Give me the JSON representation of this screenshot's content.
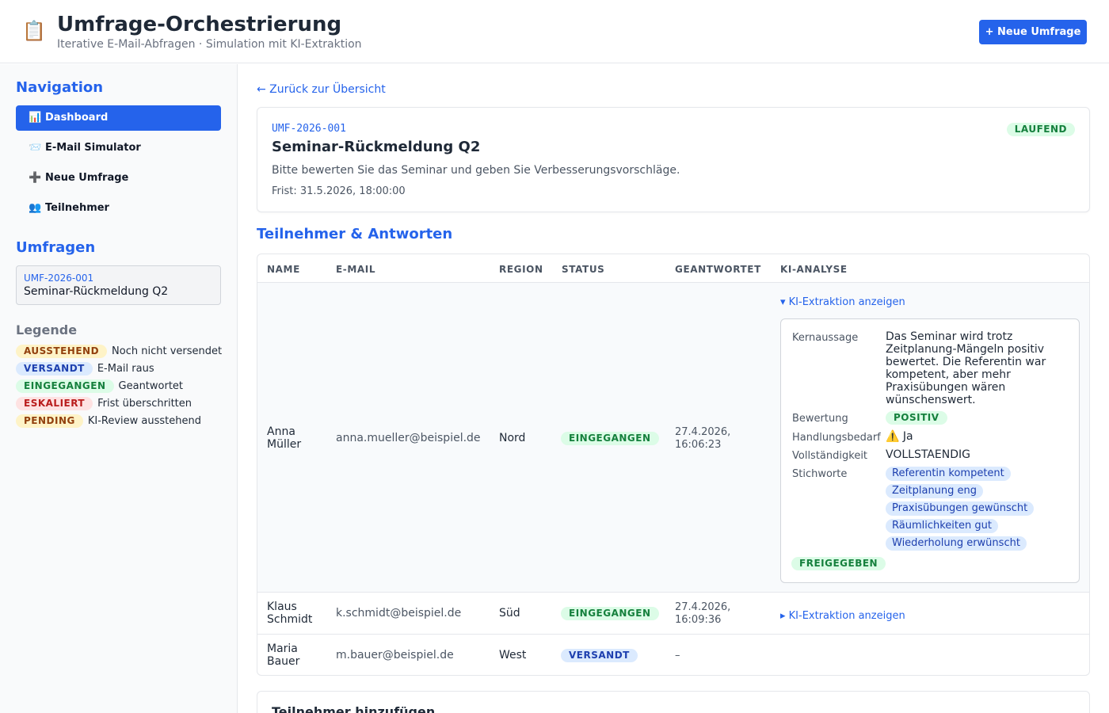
{
  "header": {
    "icon": "clipboard-icon",
    "title": "Umfrage-Orchestrierung",
    "subtitle": "Iterative E-Mail-Abfragen · Simulation mit KI-Extraktion",
    "new_survey_button": "+ Neue Umfrage"
  },
  "sidebar": {
    "nav_title": "Navigation",
    "nav_items": [
      {
        "icon": "📊",
        "label": "Dashboard",
        "active": true
      },
      {
        "icon": "📨",
        "label": "E-Mail Simulator",
        "active": false
      },
      {
        "icon": "➕",
        "label": "Neue Umfrage",
        "active": false
      },
      {
        "icon": "👥",
        "label": "Teilnehmer",
        "active": false
      }
    ],
    "surveys_title": "Umfragen",
    "surveys": [
      {
        "id": "UMF-2026-001",
        "title": "Seminar-Rückmeldung Q2"
      }
    ],
    "legend_title": "Legende",
    "legend": [
      {
        "badge": "AUSSTEHEND",
        "text": "Noch nicht versendet",
        "color": "#fef3c7"
      },
      {
        "badge": "VERSANDT",
        "text": "E-Mail raus",
        "color": "#dbeafe"
      },
      {
        "badge": "EINGEGANGEN",
        "text": "Geantwortet",
        "color": "#dcfce7"
      },
      {
        "badge": "ESKALIERT",
        "text": "Frist überschritten",
        "color": "#fee2e2"
      },
      {
        "badge": "PENDING",
        "text": "KI-Review ausstehend",
        "color": "#fef3c7"
      }
    ]
  },
  "main": {
    "back_link": "← Zurück zur Übersicht",
    "survey": {
      "id": "UMF-2026-001",
      "status": "LAUFEND",
      "title": "Seminar-Rückmeldung Q2",
      "description": "Bitte bewerten Sie das Seminar und geben Sie Verbesserungsvorschläge.",
      "deadline": "Frist: 31.5.2026, 18:00:00"
    },
    "participants_title": "Teilnehmer & Antworten",
    "table": {
      "headers": [
        "NAME",
        "E-MAIL",
        "REGION",
        "STATUS",
        "GEANTWORTET",
        "KI-ANALYSE"
      ],
      "rows": [
        {
          "name_line1": "Anna",
          "name_line2": "Müller",
          "email": "anna.mueller@beispiel.de",
          "region": "Nord",
          "status": "EINGEGANGEN",
          "answered_line1": "27.4.2026,",
          "answered_line2": "16:06:23",
          "ai_toggle": "▾ KI-Extraktion anzeigen",
          "ai": {
            "summary_label": "Kernaussage",
            "summary_lines": [
              "Das Seminar wird trotz",
              "Zeitplanung-Mängeln positiv",
              "bewertet. Die Referentin war",
              "kompetent, aber mehr",
              "Praxisübungen wären",
              "wünschenswert."
            ],
            "rating_label": "Bewertung",
            "rating": "POSITIV",
            "action_label": "Handlungsbedarf",
            "action": "⚠️ Ja",
            "completeness_label": "Vollständigkeit",
            "completeness": "VOLLSTAENDIG",
            "keywords_label": "Stichworte",
            "keywords": [
              "Referentin kompetent",
              "Zeitplanung eng",
              "Praxisübungen gewünscht",
              "Räumlichkeiten gut",
              "Wiederholung erwünscht"
            ],
            "review_status": "FREIGEGEBEN"
          }
        },
        {
          "name_line1": "Klaus",
          "name_line2": "Schmidt",
          "email": "k.schmidt@beispiel.de",
          "region": "Süd",
          "status": "EINGEGANGEN",
          "answered_line1": "27.4.2026,",
          "answered_line2": "16:09:36",
          "ai_toggle": "▸ KI-Extraktion anzeigen"
        },
        {
          "name_line1": "Maria",
          "name_line2": "Bauer",
          "email": "m.bauer@beispiel.de",
          "region": "West",
          "status": "VERSANDT",
          "answered_line1": "–"
        }
      ]
    },
    "add_participant_title": "Teilnehmer hinzufügen"
  },
  "colors": {
    "accent": "#2563eb",
    "success": "#15803d",
    "warning": "#92400e",
    "danger": "#b91c1c"
  }
}
